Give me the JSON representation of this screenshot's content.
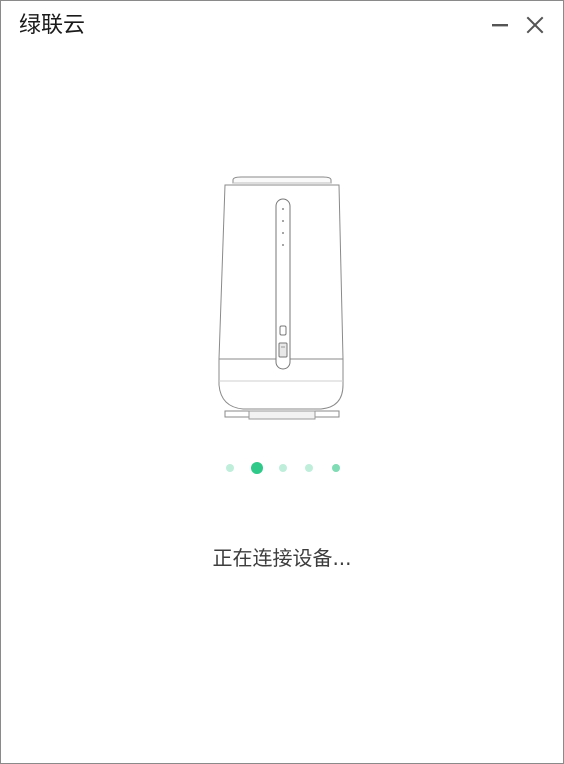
{
  "window": {
    "title": "绿联云",
    "minimize_icon": "minimize-icon",
    "close_icon": "close-icon"
  },
  "pager": {
    "count": 5,
    "active_index": 1,
    "colors": {
      "active": "#2fc98a",
      "inactive": "#bfeedb"
    }
  },
  "status": {
    "text": "正在连接设备..."
  }
}
